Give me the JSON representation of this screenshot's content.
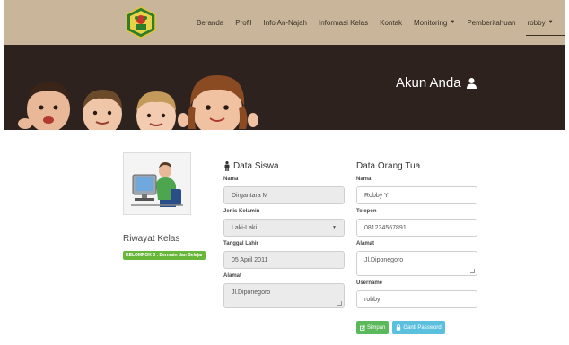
{
  "navbar": {
    "items": [
      {
        "label": "Beranda"
      },
      {
        "label": "Profil"
      },
      {
        "label": "Info An-Najah"
      },
      {
        "label": "Informasi Kelas"
      },
      {
        "label": "Kontak"
      },
      {
        "label": "Monitoring",
        "dropdown": true
      },
      {
        "label": "Pemberitahuan"
      },
      {
        "label": "robby",
        "dropdown": true
      }
    ]
  },
  "hero": {
    "title": "Akun Anda"
  },
  "sidebar": {
    "riwayat_title": "Riwayat Kelas",
    "kelompok_badge": "KELOMPOK 3 : Bermain dan Belajar"
  },
  "data_siswa": {
    "title": "Data Siswa",
    "nama_label": "Nama",
    "nama_value": "Dirgantara M",
    "jk_label": "Jenis Kelamin",
    "jk_value": "Laki-Laki",
    "tgl_label": "Tanggal Lahir",
    "tgl_value": "05 April 2011",
    "alamat_label": "Alamat",
    "alamat_value": "Jl.Diponegoro"
  },
  "data_ortu": {
    "title": "Data Orang Tua",
    "nama_label": "Nama",
    "nama_value": "Robby Y",
    "telepon_label": "Telepon",
    "telepon_value": "081234567891",
    "alamat_label": "Alamat",
    "alamat_value": "Jl.Diponegoro",
    "username_label": "Username",
    "username_value": "robby"
  },
  "buttons": {
    "simpan": "Simpan",
    "ganti_password": "Ganti Password"
  },
  "colors": {
    "navbar": "#c9b69a",
    "hero": "#2e221f",
    "badge": "#69b73a",
    "save": "#5cb85c",
    "info": "#5bc0de"
  },
  "icons": [
    "school-logo",
    "user-icon",
    "male-icon",
    "edit-icon",
    "lock-icon"
  ]
}
